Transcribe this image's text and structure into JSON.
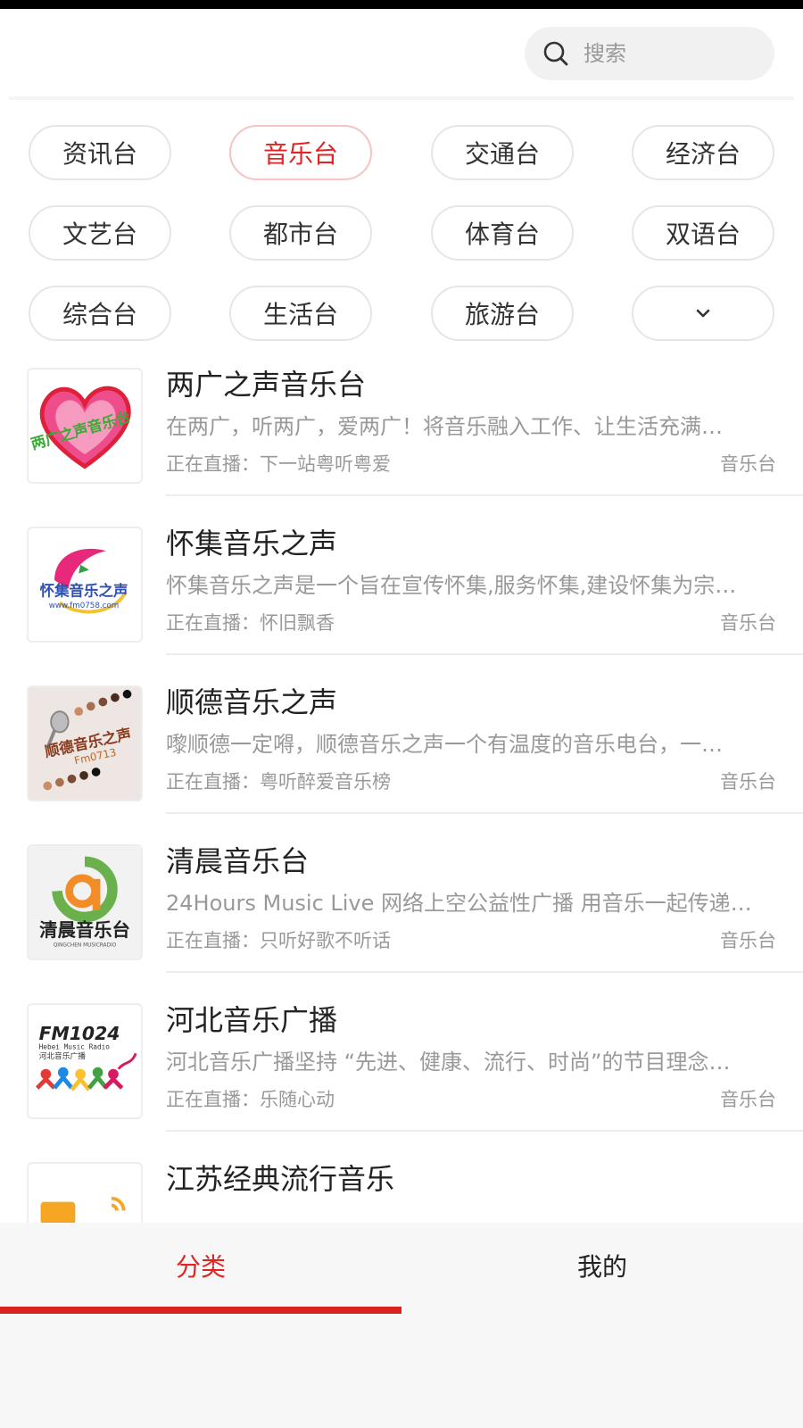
{
  "search": {
    "placeholder": "搜索"
  },
  "categories": [
    {
      "label": "资讯台",
      "active": false
    },
    {
      "label": "音乐台",
      "active": true
    },
    {
      "label": "交通台",
      "active": false
    },
    {
      "label": "经济台",
      "active": false
    },
    {
      "label": "文艺台",
      "active": false
    },
    {
      "label": "都市台",
      "active": false
    },
    {
      "label": "体育台",
      "active": false
    },
    {
      "label": "双语台",
      "active": false
    },
    {
      "label": "综合台",
      "active": false
    },
    {
      "label": "生活台",
      "active": false
    },
    {
      "label": "旅游台",
      "active": false
    }
  ],
  "more_icon": "chevron-down-icon",
  "stations": [
    {
      "title": "两广之声音乐台",
      "desc": "在两广，听两广，爱两广！将音乐融入工作、让生活充满…",
      "live": "正在直播：下一站粤听粤爱",
      "category": "音乐台",
      "logo_text": "两广之声音乐台"
    },
    {
      "title": "怀集音乐之声",
      "desc": "怀集音乐之声是一个旨在宣传怀集,服务怀集,建设怀集为宗…",
      "live": "正在直播：怀旧飘香",
      "category": "音乐台",
      "logo_text": "怀集音乐之声",
      "logo_subtext": "www.fm0758.com"
    },
    {
      "title": "顺德音乐之声",
      "desc": "嚟顺德一定嘚，顺德音乐之声一个有温度的音乐电台，一…",
      "live": "正在直播：粤听醉爱音乐榜",
      "category": "音乐台",
      "logo_text": "顺德音乐之声",
      "logo_subtext": "Fm0713"
    },
    {
      "title": "清晨音乐台",
      "desc": "24Hours Music Live 网络上空公益性广播 用音乐一起传递…",
      "live": "正在直播：只听好歌不听话",
      "category": "音乐台",
      "logo_text": "清晨音乐台",
      "logo_subtext": "QINGCHEN MUSICRADIO"
    },
    {
      "title": "河北音乐广播",
      "desc": "河北音乐广播坚持 “先进、健康、流行、时尚”的节目理念…",
      "live": "正在直播：乐随心动",
      "category": "音乐台",
      "logo_text": "FM1024",
      "logo_subtext": "Hebei Music Radio",
      "logo_subtext2": "河北音乐广播"
    },
    {
      "title": "江苏经典流行音乐",
      "desc": "",
      "live": "",
      "category": ""
    }
  ],
  "bottom_nav": [
    {
      "label": "分类",
      "active": true
    },
    {
      "label": "我的",
      "active": false
    }
  ],
  "colors": {
    "accent": "#e02424",
    "chip_border": "#e6e6e6",
    "secondary_text": "#999999"
  }
}
